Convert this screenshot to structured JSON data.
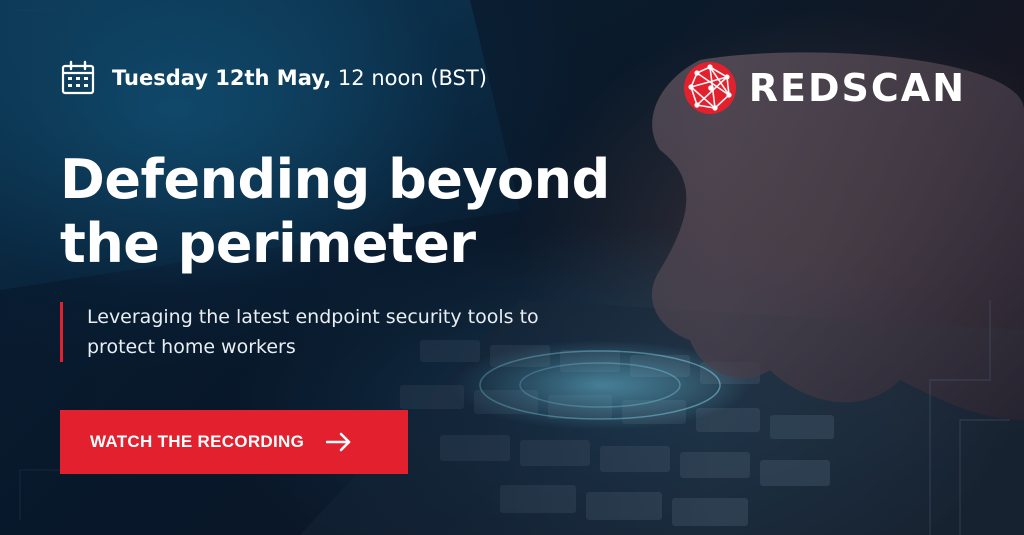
{
  "event": {
    "date_bold": "Tuesday 12th May,",
    "date_time": " 12 noon (BST)"
  },
  "brand": {
    "name": "REDSCAN",
    "logo_icon": "redscan-network-sphere-icon",
    "accent_color": "#e3202d"
  },
  "headline": "Defending beyond the perimeter",
  "subtitle": "Leveraging the latest endpoint security tools to protect home workers",
  "cta": {
    "label": "WATCH THE RECORDING",
    "icon": "arrow-right-icon"
  },
  "icons": {
    "calendar": "calendar-icon"
  }
}
